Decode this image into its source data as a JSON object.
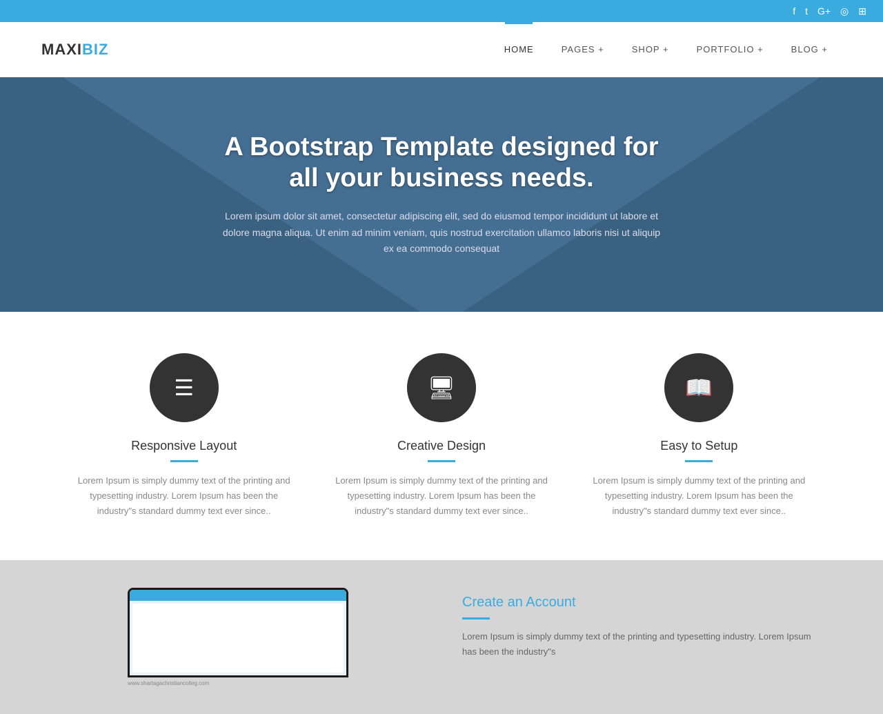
{
  "topbar": {
    "icons": [
      "f",
      "t",
      "g+",
      "d",
      "rss"
    ]
  },
  "header": {
    "logo_maxi": "MAXI",
    "logo_biz": "BIZ",
    "nav": [
      {
        "label": "HOME",
        "active": true
      },
      {
        "label": "PAGES +",
        "active": false
      },
      {
        "label": "SHOP +",
        "active": false
      },
      {
        "label": "PORTFOLIO +",
        "active": false
      },
      {
        "label": "BLOG +",
        "active": false
      }
    ]
  },
  "hero": {
    "title": "A Bootstrap Template designed for\nall your business needs.",
    "subtitle": "Lorem ipsum dolor sit amet, consectetur adipiscing elit, sed do eiusmod tempor incididunt ut labore et dolore magna aliqua. Ut enim ad minim veniam, quis nostrud exercitation ullamco laboris nisi ut aliquip ex ea commodo consequat"
  },
  "features": [
    {
      "icon": "☰",
      "title": "Responsive Layout",
      "text": "Lorem Ipsum is simply dummy text of the printing and typesetting industry. Lorem Ipsum has been the industry\"s standard dummy text ever since.."
    },
    {
      "icon": "🖥",
      "title": "Creative Design",
      "text": "Lorem Ipsum is simply dummy text of the printing and typesetting industry. Lorem Ipsum has been the industry\"s standard dummy text ever since.."
    },
    {
      "icon": "📖",
      "title": "Easy to Setup",
      "text": "Lorem Ipsum is simply dummy text of the printing and typesetting industry. Lorem Ipsum has been the industry\"s standard dummy text ever since.."
    }
  ],
  "bottom": {
    "title": "Create an Account",
    "description": "Lorem Ipsum is simply dummy text of the printing and typesetting industry. Lorem Ipsum has been the industry\"s",
    "url_label": "www.shartagachristiancolleg.com"
  }
}
